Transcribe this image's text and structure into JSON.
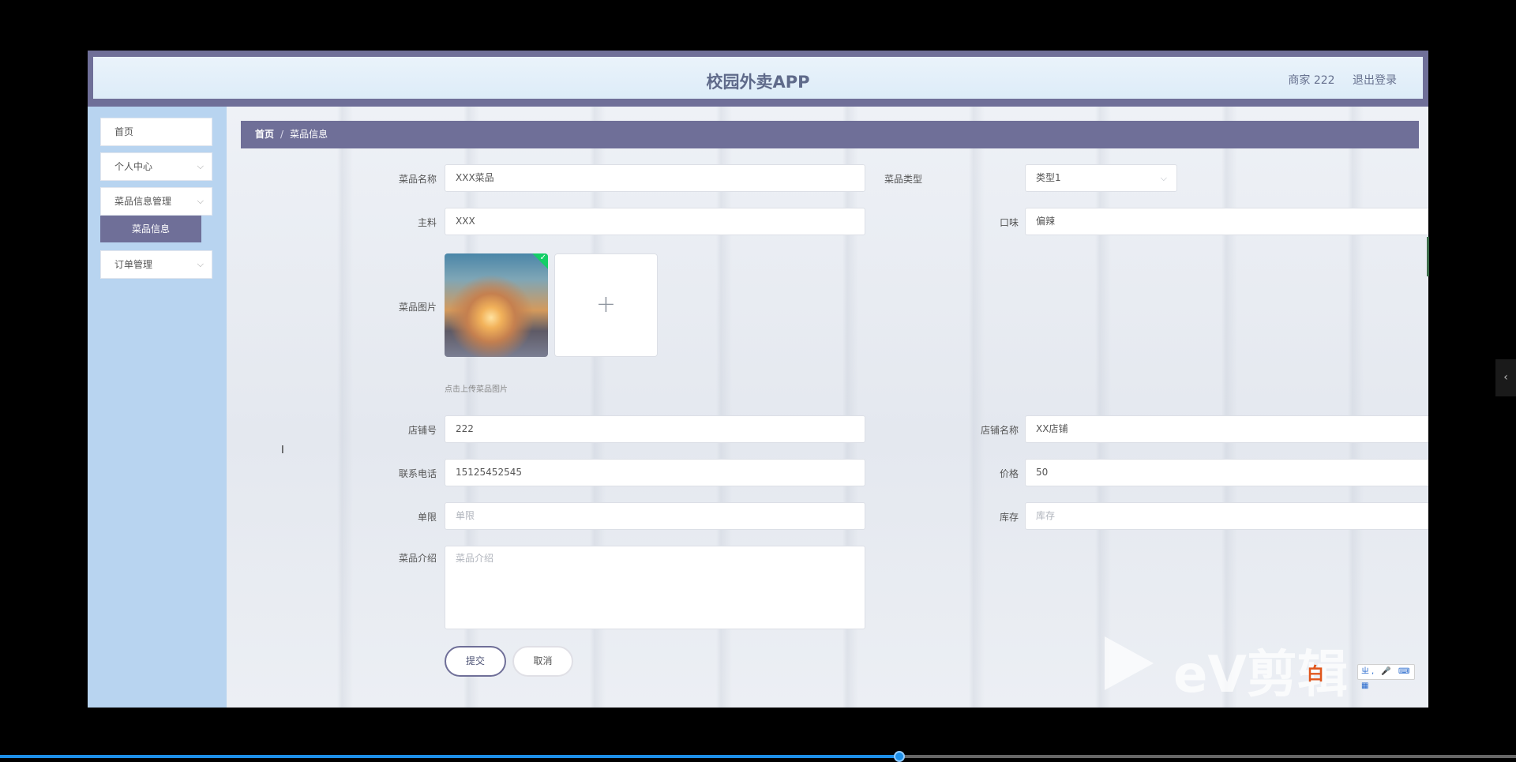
{
  "header": {
    "title": "校园外卖APP",
    "user": "商家 222",
    "logout": "退出登录"
  },
  "sidebar": {
    "items": [
      {
        "label": "首页"
      },
      {
        "label": "个人中心",
        "chevron": "⌵"
      },
      {
        "label": "菜品信息管理",
        "chevron": "⌵"
      },
      {
        "label": "订单管理",
        "chevron": "⌵"
      }
    ],
    "sub_active": "菜品信息"
  },
  "breadcrumb": {
    "home": "首页",
    "sep": "/",
    "current": "菜品信息"
  },
  "form": {
    "dish_name": {
      "label": "菜品名称",
      "value": "XXX菜品"
    },
    "dish_type": {
      "label": "菜品类型",
      "value": "类型1",
      "chevron": "⌵"
    },
    "main_ingredient": {
      "label": "主料",
      "value": "XXX"
    },
    "flavor": {
      "label": "口味",
      "value": "偏辣"
    },
    "image": {
      "label": "菜品图片",
      "upload_icon": "+",
      "hint": "点击上传菜品图片",
      "check_icon": "✓"
    },
    "shop_no": {
      "label": "店铺号",
      "value": "222"
    },
    "shop_name": {
      "label": "店铺名称",
      "value": "XX店铺"
    },
    "phone": {
      "label": "联系电话",
      "value": "15125452545"
    },
    "price": {
      "label": "价格",
      "value": "50",
      "clear_icon": "⊗"
    },
    "limit": {
      "label": "单限",
      "placeholder": "单限"
    },
    "stock": {
      "label": "库存",
      "placeholder": "库存"
    },
    "intro": {
      "label": "菜品介绍",
      "placeholder": "菜品介绍"
    },
    "submit": "提交",
    "cancel": "取消"
  },
  "overlay": {
    "watermark": "eV剪辑",
    "ime_logo": "白",
    "ime_tools": "ㄓ, 🎤 ⌨ ▦",
    "side_tab_icon": "‹",
    "cursor_icon": "I",
    "video_progress": 0.593
  },
  "colors": {
    "accent": "#6f6f98",
    "sidebar": "#b8d4f0",
    "success": "#13ce66"
  }
}
